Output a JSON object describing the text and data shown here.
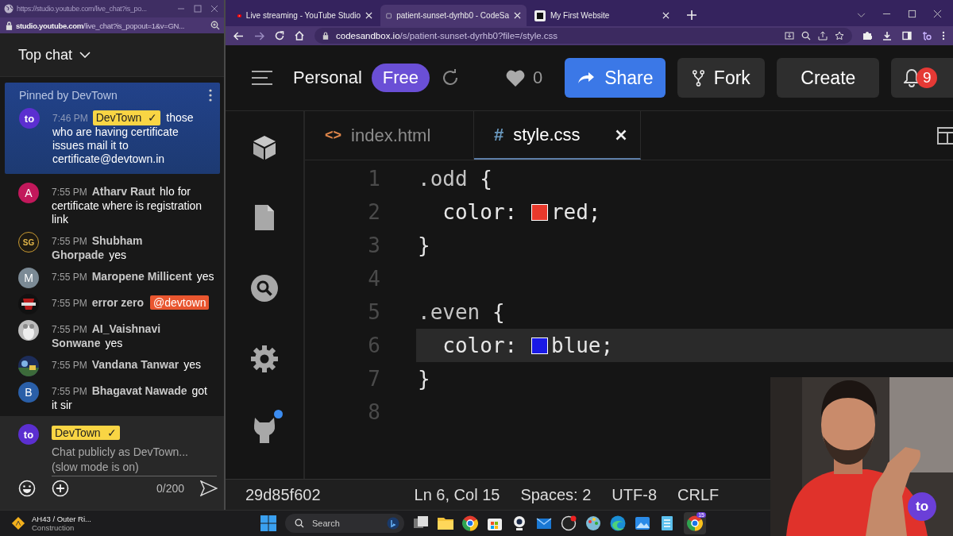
{
  "chat_window": {
    "title_url": "https://studio.youtube.com/live_chat?is_po...",
    "address": "**studio.youtube.com**/live_chat?is_popout=1&v=GN..."
  },
  "chat": {
    "title": "Top chat",
    "pinned": {
      "label": "Pinned by DevTown",
      "avatar": {
        "kind": "logo",
        "letter": "to",
        "color": "#5b2fd0"
      },
      "time": "7:46 PM",
      "author": "DevTown",
      "author_icon": "✓",
      "owner": true,
      "text": "those who are having certificate issues mail it to certificate@devtown.in"
    },
    "messages": [
      {
        "avatar": {
          "kind": "letter",
          "letter": "A",
          "color": "#c2185b"
        },
        "time": "7:55 PM",
        "author": "Atharv Raut",
        "text": "hlo for certificate where is registration link"
      },
      {
        "avatar": {
          "kind": "emblem",
          "letter": "SG",
          "color": "#1e1a12"
        },
        "time": "7:55 PM",
        "author": "Shubham Ghorpade",
        "text": "yes"
      },
      {
        "avatar": {
          "kind": "letter",
          "letter": "M",
          "color": "#7b8a95"
        },
        "time": "7:55 PM",
        "author": "Maropene Millicent",
        "text": "yes"
      },
      {
        "time": "7:55 PM",
        "author": "error zero",
        "text": "@devtown",
        "mention": true
      },
      {
        "time": "7:55 PM",
        "author": "AI_Vaishnavi Sonwane",
        "text": "yes"
      },
      {
        "time": "7:55 PM",
        "author": "Vandana Tanwar",
        "text": "yes"
      },
      {
        "avatar": {
          "kind": "letter",
          "letter": "B",
          "color": "#2a5fa8"
        },
        "time": "7:55 PM",
        "author": "Bhagavat Nawade",
        "text": "got it sir"
      }
    ],
    "input": {
      "avatar": {
        "kind": "logo",
        "letter": "to",
        "color": "#5b2fd0"
      },
      "author": "DevTown",
      "author_icon": "✓",
      "owner": true,
      "placeholder": "Chat publicly as DevTown... (slow mode is on)",
      "counter": "0/200"
    }
  },
  "browser": {
    "tabs": [
      {
        "title": "Live streaming - YouTube Studio",
        "selected": false
      },
      {
        "title": "patient-sunset-dyrhb0 - CodeSa",
        "selected": true
      },
      {
        "title": "My First Website",
        "selected": false
      }
    ],
    "address": "**codesandbox.io**/s/patient-sunset-dyrhb0?file=/style.css"
  },
  "sandbox": {
    "workspace": "Personal",
    "plan": "Free",
    "likes": "0",
    "buttons": [
      {
        "label": "Share",
        "kind": "primary"
      },
      {
        "label": "Fork",
        "kind": "fork"
      },
      {
        "label": "Create",
        "kind": "plain"
      }
    ],
    "notifications": "9",
    "editor_tabs": [
      {
        "glyph": "<>",
        "kind": "html",
        "name": "index.html",
        "selected": false
      },
      {
        "glyph": "#",
        "kind": "css",
        "name": "style.css",
        "selected": true
      }
    ],
    "lines": [
      {
        "number": "1",
        "current": false,
        "tokens": [
          {
            "kind": "selector",
            "text": ".odd"
          },
          {
            "kind": "punct",
            "text": " {"
          }
        ]
      },
      {
        "number": "2",
        "current": false,
        "tokens": [
          {
            "kind": "property",
            "text": "  color"
          },
          {
            "kind": "punct",
            "text": ": "
          },
          {
            "kind": "swatch",
            "color": "#e8392c"
          },
          {
            "kind": "value",
            "text": "red"
          },
          {
            "kind": "punct",
            "text": ";"
          }
        ]
      },
      {
        "number": "3",
        "current": false,
        "tokens": [
          {
            "kind": "punct",
            "text": "}"
          }
        ]
      },
      {
        "number": "4",
        "current": false
      },
      {
        "number": "5",
        "current": false,
        "tokens": [
          {
            "kind": "selector",
            "text": ".even"
          },
          {
            "kind": "punct",
            "text": " {"
          }
        ]
      },
      {
        "number": "6",
        "current": true,
        "tokens": [
          {
            "kind": "property",
            "text": "  color"
          },
          {
            "kind": "punct",
            "text": ": "
          },
          {
            "kind": "swatch",
            "color": "#1a1ae6"
          },
          {
            "kind": "value",
            "text": "blue"
          },
          {
            "kind": "punct",
            "text": ";"
          }
        ]
      },
      {
        "number": "7",
        "current": false,
        "tokens": [
          {
            "kind": "punct",
            "text": "}"
          }
        ]
      },
      {
        "number": "8",
        "current": false
      }
    ],
    "status": {
      "commit": "29d85f602",
      "items": [
        "Ln 6, Col 15",
        "Spaces: 2",
        "UTF-8",
        "CRLF"
      ]
    }
  },
  "overlay": {
    "kind": "picture",
    "badge": "to"
  },
  "taskbar": {
    "weather": {
      "title": "AH43 / Outer Ri...",
      "subtitle": "Construction"
    },
    "search": {
      "placeholder": "Search"
    },
    "app_badge": "15"
  }
}
